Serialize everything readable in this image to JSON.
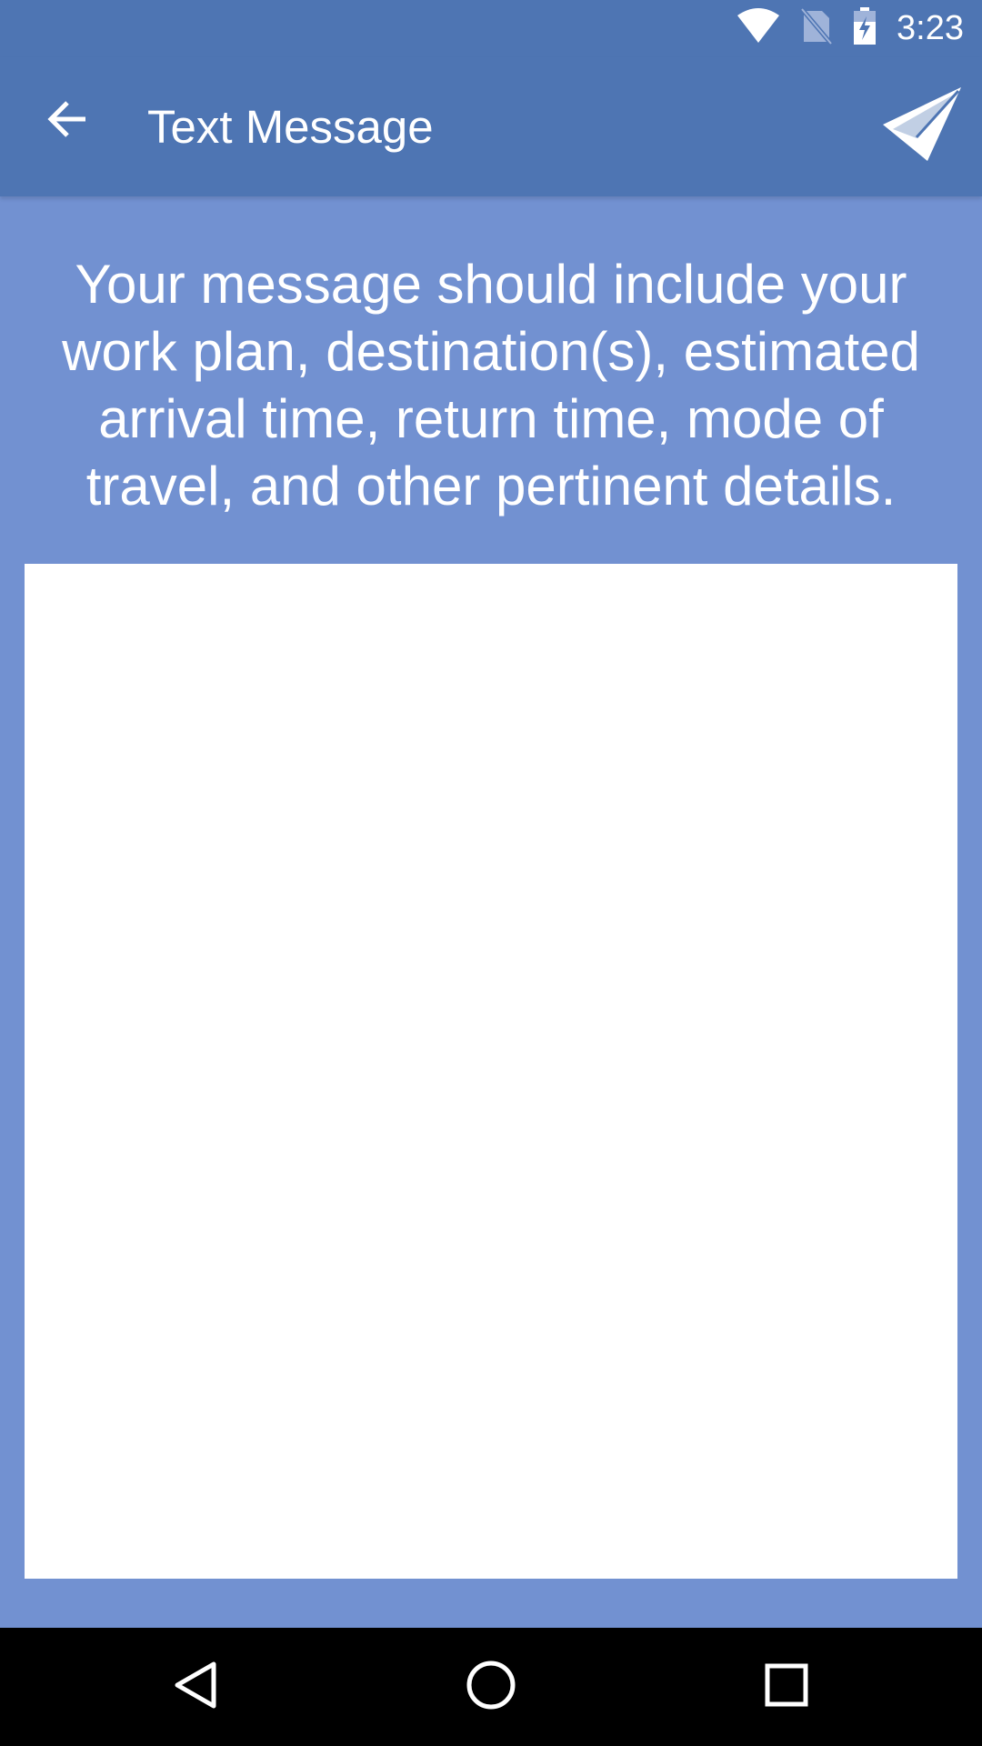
{
  "status_bar": {
    "time": "3:23",
    "icons": [
      "wifi-icon",
      "no-sim-icon",
      "battery-charging-icon"
    ]
  },
  "app_bar": {
    "title": "Text Message",
    "back_icon": "arrow-left-icon",
    "send_icon": "paper-plane-icon"
  },
  "content": {
    "instructions": "Your message should include your work plan, destination(s), estimated arrival time, return time, mode of travel, and other pertinent details.",
    "message_value": ""
  },
  "nav_bar": {
    "icons": [
      "back-triangle-icon",
      "home-circle-icon",
      "recents-square-icon"
    ]
  },
  "colors": {
    "app_bar": "#4e75b3",
    "background": "#7291d1",
    "text": "#ffffff",
    "nav_bar": "#000000"
  }
}
